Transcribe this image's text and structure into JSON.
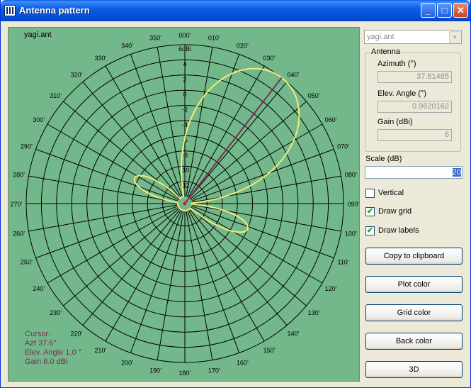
{
  "window": {
    "title": "Antenna pattern",
    "controls": {
      "minimize": "_",
      "maximize": "□",
      "close": "✕"
    }
  },
  "plot": {
    "antenna_file": "yagi.ant",
    "ring_labels": [
      "6dBi",
      "4",
      "2",
      "0",
      "-2",
      "-4",
      "-6",
      "-8",
      "-10",
      "-12"
    ],
    "azimuth_labels": [
      "000",
      "010",
      "020",
      "030",
      "040",
      "050",
      "060",
      "070",
      "080",
      "090",
      "100",
      "110",
      "120",
      "130",
      "140",
      "150",
      "160",
      "170",
      "180",
      "190",
      "200",
      "210",
      "220",
      "230",
      "240",
      "250",
      "260",
      "270",
      "280",
      "290",
      "300",
      "310",
      "320",
      "330",
      "340",
      "350"
    ],
    "cursor_info": {
      "line1": "Cursor:",
      "line2": "Azt 37.6°",
      "line3": "Elev. Angle 1.0 °",
      "line4": "Gain 6.0 dBi"
    },
    "pattern_lobes": [
      {
        "azimuth_deg": 37.6,
        "gain_dbi": 6.0
      },
      {
        "azimuth_deg": 297,
        "gain_dbi": -7.5
      },
      {
        "azimuth_deg": 112,
        "gain_dbi": -6.0
      }
    ],
    "colors": {
      "background": "#72b88a",
      "grid": "#000000",
      "plot": "#f0ec78",
      "cursor": "#7a2c55"
    }
  },
  "panel": {
    "antenna_select": "yagi.ant",
    "group_title": "Antenna",
    "azimuth_label": "Azimuth (°)",
    "azimuth_value": "37.61485",
    "elev_label": "Elev. Angle (°)",
    "elev_value": "0.9620162",
    "gain_label": "Gain (dBi)",
    "gain_value": "6",
    "scale_label": "Scale (dB)",
    "scale_value": "20",
    "vertical_label": "Vertical",
    "vertical_checked": false,
    "draw_grid_label": "Draw grid",
    "draw_grid_checked": true,
    "draw_labels_label": "Draw labels",
    "draw_labels_checked": true,
    "copy_button": "Copy to clipboard",
    "plot_color_button": "Plot color",
    "grid_color_button": "Grid color",
    "back_color_button": "Back color",
    "three_d_button": "3D"
  }
}
